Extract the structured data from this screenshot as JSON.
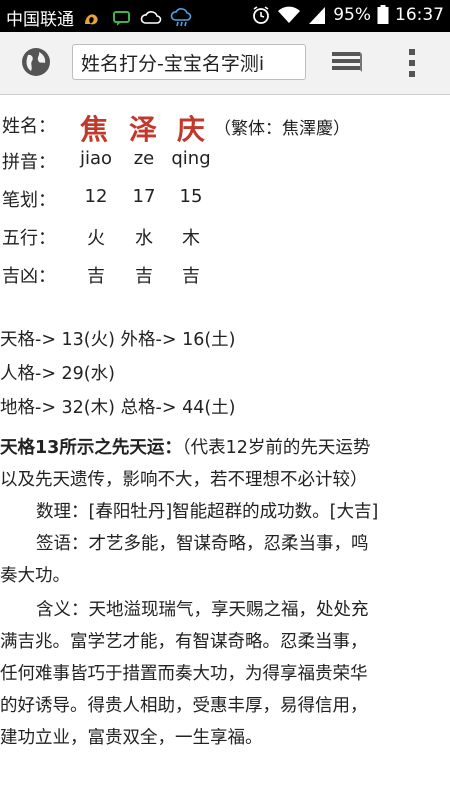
{
  "statusbar": {
    "carrier": "中国联通",
    "battery": "95%",
    "time": "16:37"
  },
  "browser": {
    "url_text": "姓名打分-宝宝名字测i"
  },
  "name": {
    "label": "姓名：",
    "chars": [
      "焦",
      "泽",
      "庆"
    ],
    "traditional": "（繁体：焦澤慶）"
  },
  "rows": [
    {
      "label": "拼音：",
      "values": [
        "jiao",
        "ze",
        "qing"
      ]
    },
    {
      "label": "笔划：",
      "values": [
        "12",
        "17",
        "15"
      ]
    },
    {
      "label": "五行：",
      "values": [
        "火",
        "水",
        "木"
      ]
    },
    {
      "label": "吉凶：",
      "values": [
        "吉",
        "吉",
        "吉"
      ]
    }
  ],
  "ge": {
    "line1": "天格-> 13(火) 外格-> 16(土)",
    "line2": "人格-> 29(水)",
    "line3": "地格-> 32(木) 总格-> 44(土)"
  },
  "fortune": {
    "title": "天格13所示之先天运：",
    "note_part1": "（代表12岁前的先天运势",
    "note_part2": "以及先天遗传，影响不大，若不理想不必计较）",
    "shuli": "数理：[春阳牡丹]智能超群的成功数。[大吉]",
    "qianyu_1": "签语：才艺多能，智谋奇略，忍柔当事，鸣",
    "qianyu_2": "奏大功。",
    "hanyi_1": "含义：天地溢现瑞气，享天赐之福，处处充",
    "hanyi_2": "满吉兆。富学艺才能，有智谋奇略。忍柔当事，",
    "hanyi_3": "任何难事皆巧于措置而奏大功，为得享福贵荣华",
    "hanyi_4": "的好诱导。得贵人相助，受惠丰厚，易得信用，",
    "hanyi_5": "建功立业，富贵双全，一生享福。"
  },
  "colors": {
    "name_red": "#c0392b",
    "toolbar_bg": "#f2f2f2",
    "statusbar_bg": "#000000"
  }
}
